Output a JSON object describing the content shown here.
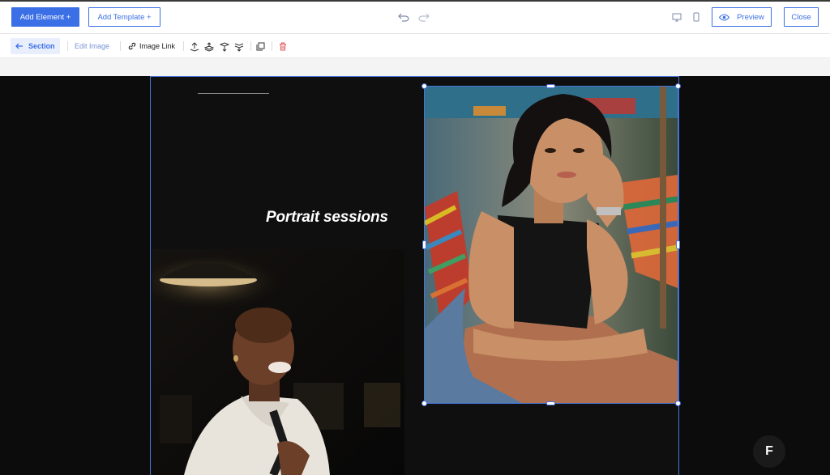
{
  "topbar": {
    "add_element": "Add Element +",
    "add_template": "Add Template +",
    "preview": "Preview",
    "close": "Close",
    "icons": [
      "undo-icon",
      "redo-icon",
      "desktop-icon",
      "mobile-icon",
      "eye-icon"
    ]
  },
  "toolbar": {
    "section": "Section",
    "edit_image": "Edit Image",
    "image_link": "Image Link",
    "icons": [
      "back-arrow-icon",
      "link-icon",
      "move-up-icon",
      "move-up-layer-icon",
      "move-down-layer-icon",
      "move-down-icon",
      "duplicate-icon",
      "delete-icon"
    ]
  },
  "canvas": {
    "headline": "Portrait sessions",
    "badge": "F"
  },
  "colors": {
    "accent": "#3b6fe6",
    "canvas_bg": "#0c0c0c",
    "selection": "#4a73d8",
    "delete": "#e05555"
  }
}
